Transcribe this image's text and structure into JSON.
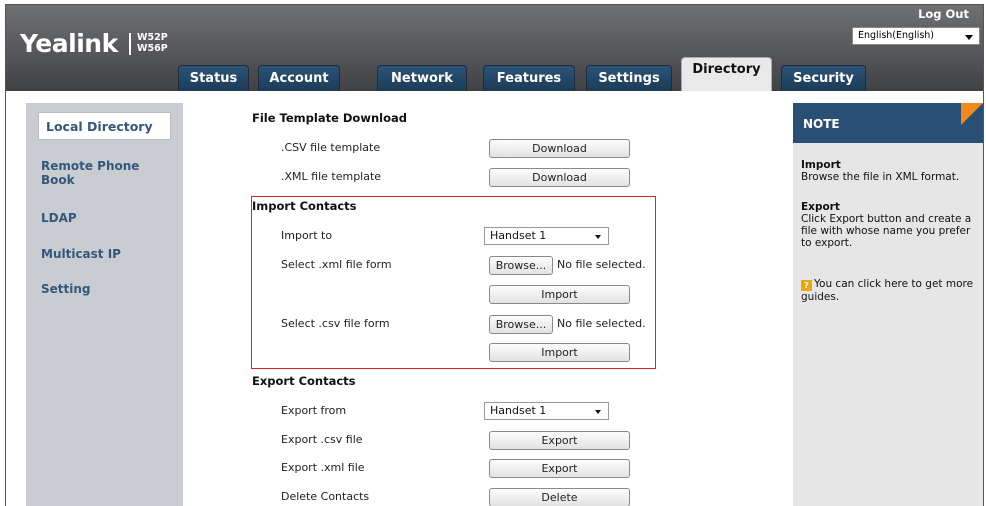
{
  "header": {
    "logo": "Yealink",
    "models": [
      "W52P",
      "W56P"
    ],
    "logout": "Log Out",
    "language": "English(English)"
  },
  "tabs": [
    {
      "label": "Status"
    },
    {
      "label": "Account"
    },
    {
      "label": "Network"
    },
    {
      "label": "Features"
    },
    {
      "label": "Settings"
    },
    {
      "label": "Directory",
      "active": true
    },
    {
      "label": "Security"
    }
  ],
  "sidebar": {
    "items": [
      {
        "label": "Local Directory",
        "active": true
      },
      {
        "label": "Remote Phone Book"
      },
      {
        "label": "LDAP"
      },
      {
        "label": "Multicast IP"
      },
      {
        "label": "Setting"
      }
    ]
  },
  "main": {
    "template": {
      "title": "File Template Download",
      "csv_label": ".CSV file template",
      "xml_label": ".XML file template",
      "download": "Download"
    },
    "import": {
      "title": "Import Contacts",
      "import_to_label": "Import to",
      "import_to_value": "Handset 1",
      "xml_label": "Select .xml file form",
      "csv_label": "Select .csv file form",
      "browse": "Browse...",
      "no_file": "No file selected.",
      "import_btn": "Import"
    },
    "export": {
      "title": "Export Contacts",
      "export_from_label": "Export from",
      "export_from_value": "Handset 1",
      "csv_label": "Export .csv file",
      "xml_label": "Export .xml file",
      "delete_label": "Delete Contacts",
      "export_btn": "Export",
      "delete_btn": "Delete"
    }
  },
  "note": {
    "title": "NOTE",
    "import_title": "Import",
    "import_text": "Browse the file in XML format.",
    "export_title": "Export",
    "export_text": "Click Export button and create a file with whose name you prefer to export.",
    "guide_text": "You can click here to get more guides.",
    "colors": {
      "accent": "#f08a1c",
      "header": "#2a4f75"
    }
  }
}
